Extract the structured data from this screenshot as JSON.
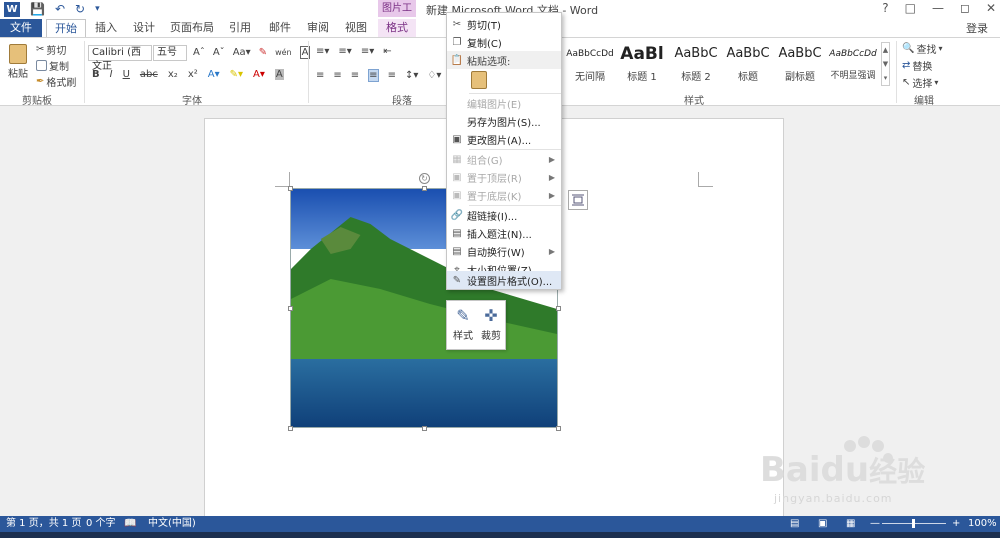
{
  "titlebar": {
    "title": "新建 Microsoft Word 文档 - Word",
    "context_tab_group": "图片工具",
    "help": "?",
    "signin": "登录"
  },
  "tabs": [
    "文件",
    "开始",
    "插入",
    "设计",
    "页面布局",
    "引用",
    "邮件",
    "审阅",
    "视图",
    "格式"
  ],
  "active_tab": "开始",
  "ribbon": {
    "clipboard": {
      "paste": "粘贴",
      "cut": "剪切",
      "copy": "复制",
      "format_painter": "格式刷",
      "group_label": "剪贴板"
    },
    "font": {
      "font_name": "Calibri (西文正",
      "font_size": "五号",
      "bold": "B",
      "italic": "I",
      "underline": "U",
      "strike": "abc",
      "sub": "x₂",
      "sup": "x²",
      "group_label": "字体"
    },
    "paragraph": {
      "group_label": "段落"
    },
    "styles": {
      "items": [
        {
          "sample": "AaBbCcDd",
          "name": "无间隔"
        },
        {
          "sample": "AaBl",
          "name": "标题 1"
        },
        {
          "sample": "AaBbC",
          "name": "标题 2"
        },
        {
          "sample": "AaBbC",
          "name": "标题"
        },
        {
          "sample": "AaBbC",
          "name": "副标题"
        },
        {
          "sample": "AaBbCcDd",
          "name": "不明显强调"
        }
      ],
      "group_label": "样式"
    },
    "editing": {
      "find": "查找",
      "replace": "替换",
      "select": "选择",
      "group_label": "编辑"
    }
  },
  "context_menu": {
    "items": [
      {
        "label": "剪切(T)",
        "icon": "scissors-icon",
        "disabled": false
      },
      {
        "label": "复制(C)",
        "icon": "copy-icon",
        "disabled": false
      },
      {
        "label": "粘贴选项:",
        "icon": "paste-icon",
        "disabled": false
      },
      {
        "label": "编辑图片(E)",
        "icon": "",
        "disabled": true
      },
      {
        "label": "另存为图片(S)...",
        "icon": "",
        "disabled": false
      },
      {
        "label": "更改图片(A)...",
        "icon": "change-picture-icon",
        "disabled": false
      },
      {
        "label": "组合(G)",
        "icon": "group-icon",
        "disabled": true
      },
      {
        "label": "置于顶层(R)",
        "icon": "bring-front-icon",
        "disabled": true
      },
      {
        "label": "置于底层(K)",
        "icon": "send-back-icon",
        "disabled": true
      },
      {
        "label": "超链接(I)...",
        "icon": "hyperlink-icon",
        "disabled": false
      },
      {
        "label": "插入题注(N)...",
        "icon": "caption-icon",
        "disabled": false
      },
      {
        "label": "自动换行(W)",
        "icon": "wrap-icon",
        "disabled": false
      },
      {
        "label": "大小和位置(Z)...",
        "icon": "size-icon",
        "disabled": false
      },
      {
        "label": "设置图片格式(O)...",
        "icon": "format-picture-icon",
        "disabled": false
      }
    ]
  },
  "mini_toolbar": {
    "style": "样式",
    "crop": "裁剪"
  },
  "statusbar": {
    "page": "第 1 页，共 1 页",
    "words": "0 个字",
    "language": "中文(中国)",
    "zoom": "100%"
  },
  "watermark": {
    "brand": "Bai",
    "brand2": "du",
    "cn": "经验",
    "url": "jingyan.baidu.com"
  }
}
